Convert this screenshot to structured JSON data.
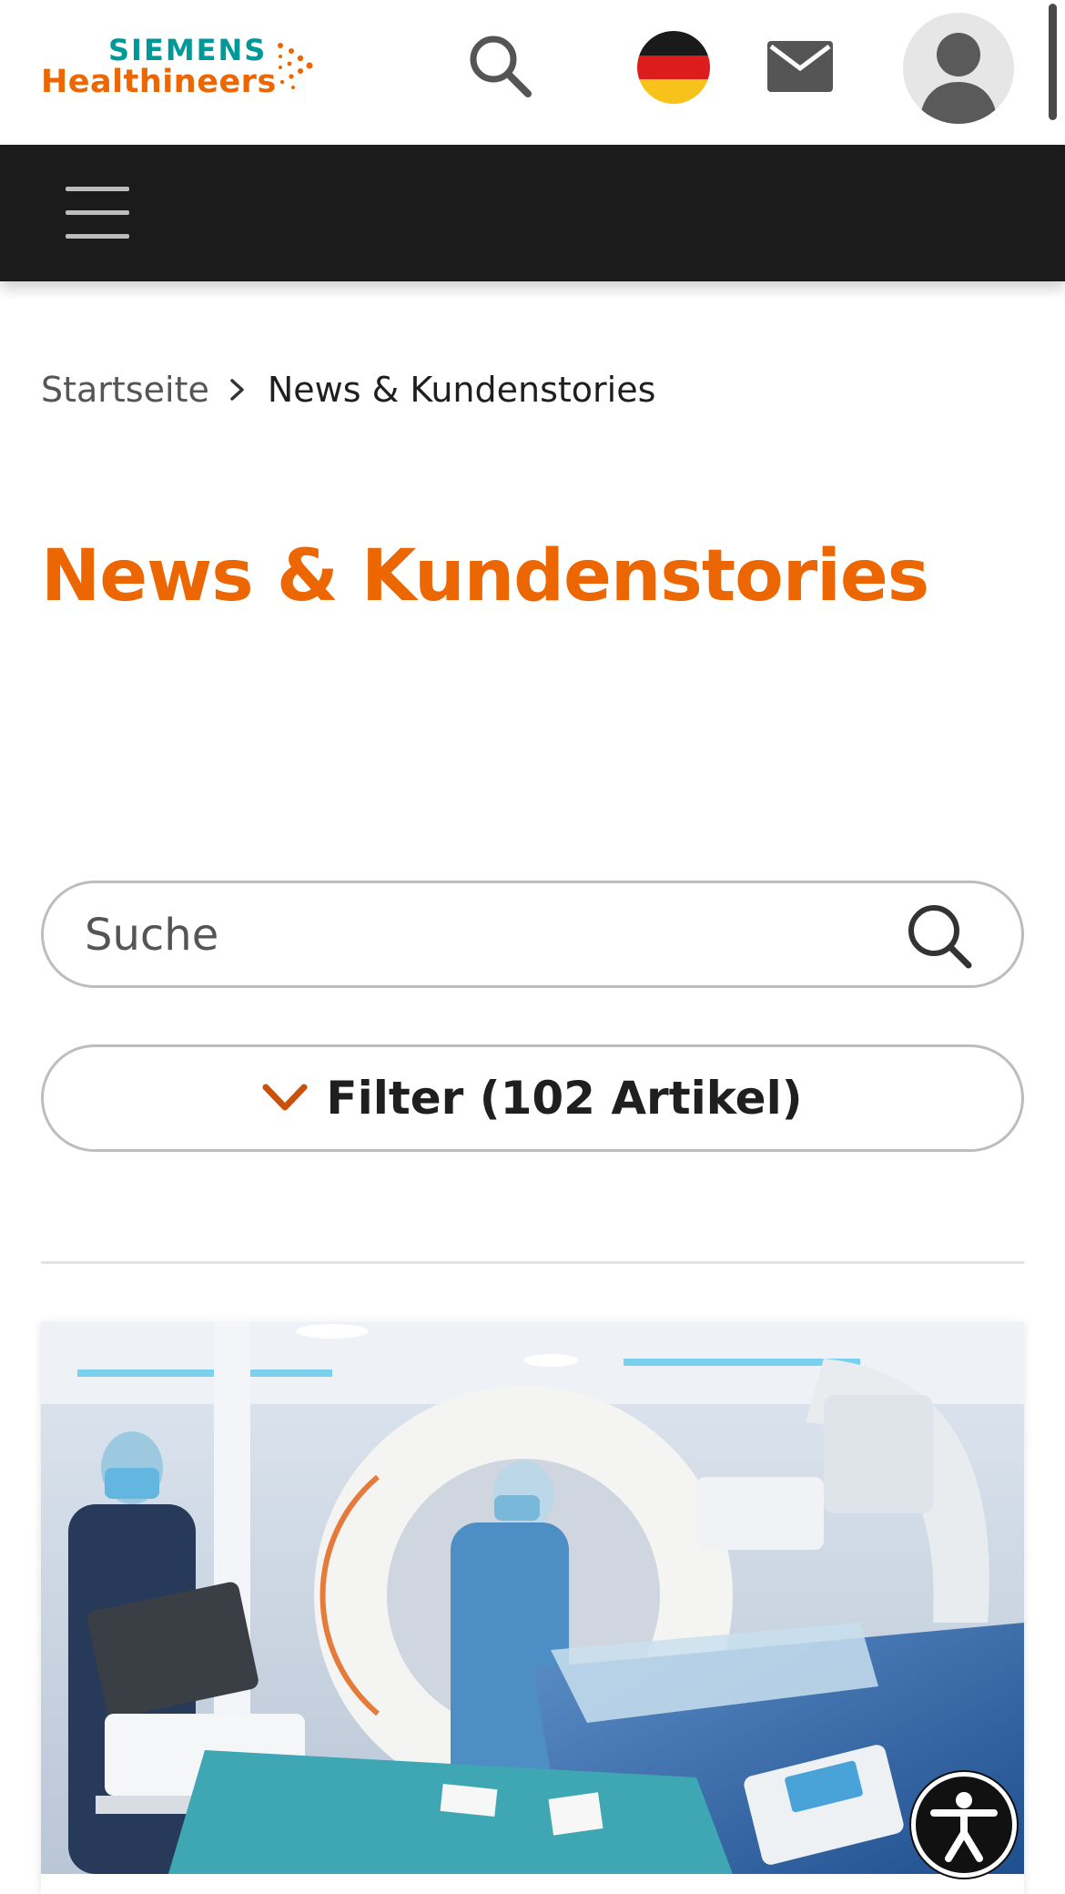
{
  "header": {
    "logo": {
      "line1": "SIEMENS",
      "line2": "Healthineers"
    },
    "icons": [
      "search-icon",
      "germany-flag-icon",
      "mail-icon",
      "user-avatar-icon"
    ]
  },
  "navbar": {
    "menu_icon": "hamburger-icon"
  },
  "breadcrumb": {
    "home": "Startseite",
    "current": "News & Kundenstories"
  },
  "main": {
    "title": "News & Kundenstories",
    "search": {
      "placeholder": "Suche",
      "value": ""
    },
    "filter": {
      "label": "Filter (102 Artikel)"
    }
  },
  "card": {
    "image_icon": "hybrid-or-photo"
  },
  "accessibility": {
    "icon": "accessibility-icon"
  },
  "colors": {
    "brand_orange": "#ec6602",
    "brand_teal": "#009999",
    "nav_bg": "#1b1b1b"
  }
}
